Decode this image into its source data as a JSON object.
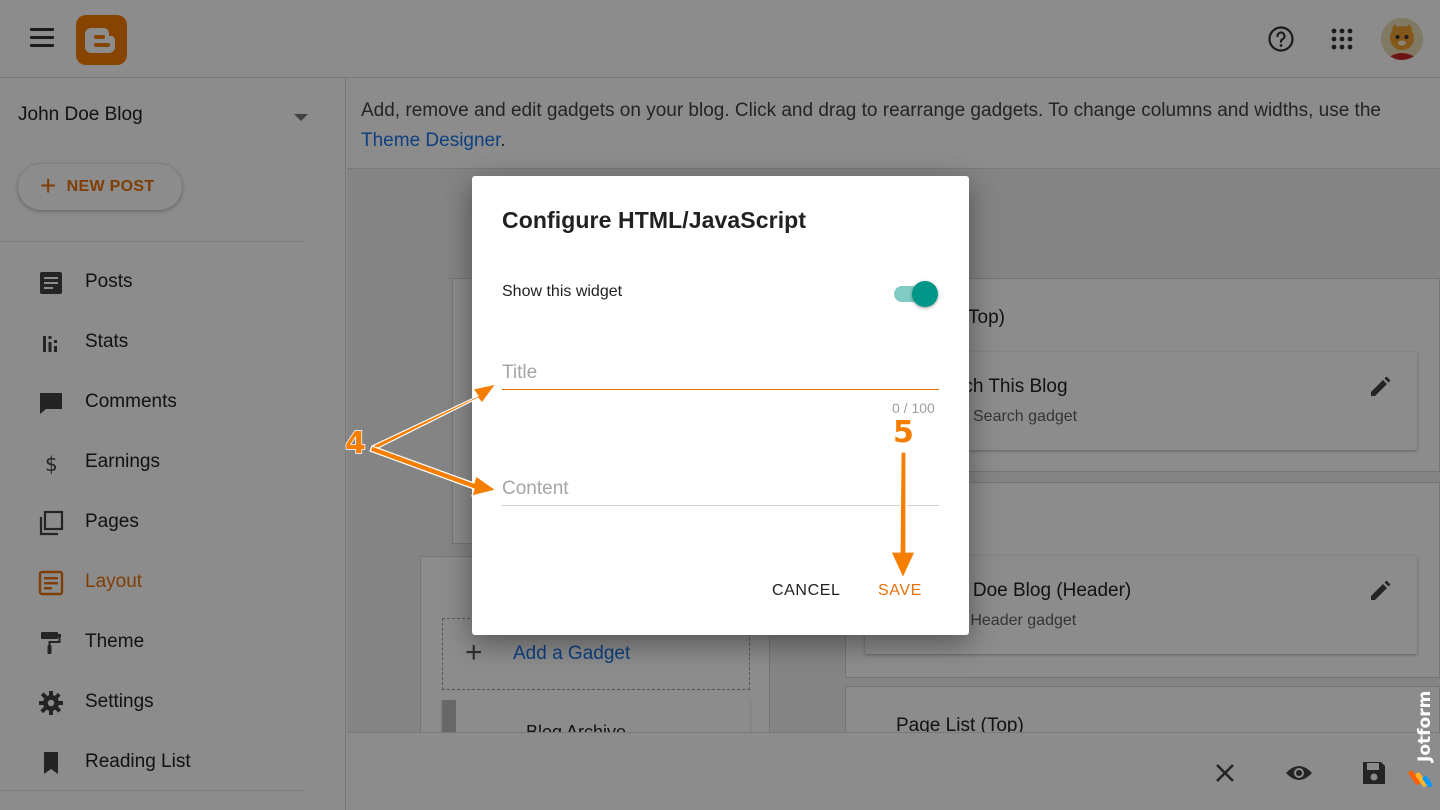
{
  "app": {
    "blog_name": "John Doe Blog",
    "new_post_label": "NEW POST"
  },
  "nav": [
    {
      "label": "Posts",
      "icon": "posts-icon"
    },
    {
      "label": "Stats",
      "icon": "stats-icon"
    },
    {
      "label": "Comments",
      "icon": "comments-icon"
    },
    {
      "label": "Earnings",
      "icon": "earnings-icon"
    },
    {
      "label": "Pages",
      "icon": "pages-icon"
    },
    {
      "label": "Layout",
      "icon": "layout-icon",
      "active": true
    },
    {
      "label": "Theme",
      "icon": "theme-icon"
    },
    {
      "label": "Settings",
      "icon": "settings-icon"
    },
    {
      "label": "Reading List",
      "icon": "reading-list-icon"
    }
  ],
  "main": {
    "intro": "Add, remove and edit gadgets on your blog. Click and drag to rearrange gadgets. To change columns and widths, use the ",
    "theme_link": "Theme Designer",
    "intro_end": ".",
    "section_top_partial": "Top)",
    "search_gadget_title_partial": "rch This Blog",
    "search_gadget_sub_partial": "Search gadget",
    "header_gadget_title_partial": "n Doe Blog (Header)",
    "header_gadget_sub_partial": "e Header gadget",
    "page_list_title": "Page List (Top)",
    "add_gadget": "Add a Gadget",
    "archive_partial": "Blog Archive"
  },
  "dialog": {
    "title": "Configure HTML/JavaScript",
    "show_widget_label": "Show this widget",
    "show_widget_on": true,
    "title_placeholder": "Title",
    "counter": "0 / 100",
    "content_placeholder": "Content",
    "cancel": "CANCEL",
    "save": "SAVE"
  },
  "annotations": {
    "step4": "4",
    "step5": "5"
  },
  "colors": {
    "accent": "#e8710a",
    "blogger_orange": "#f57d00",
    "toggle_on": "#009688",
    "link": "#1a73e8"
  },
  "watermark": "Jotform"
}
